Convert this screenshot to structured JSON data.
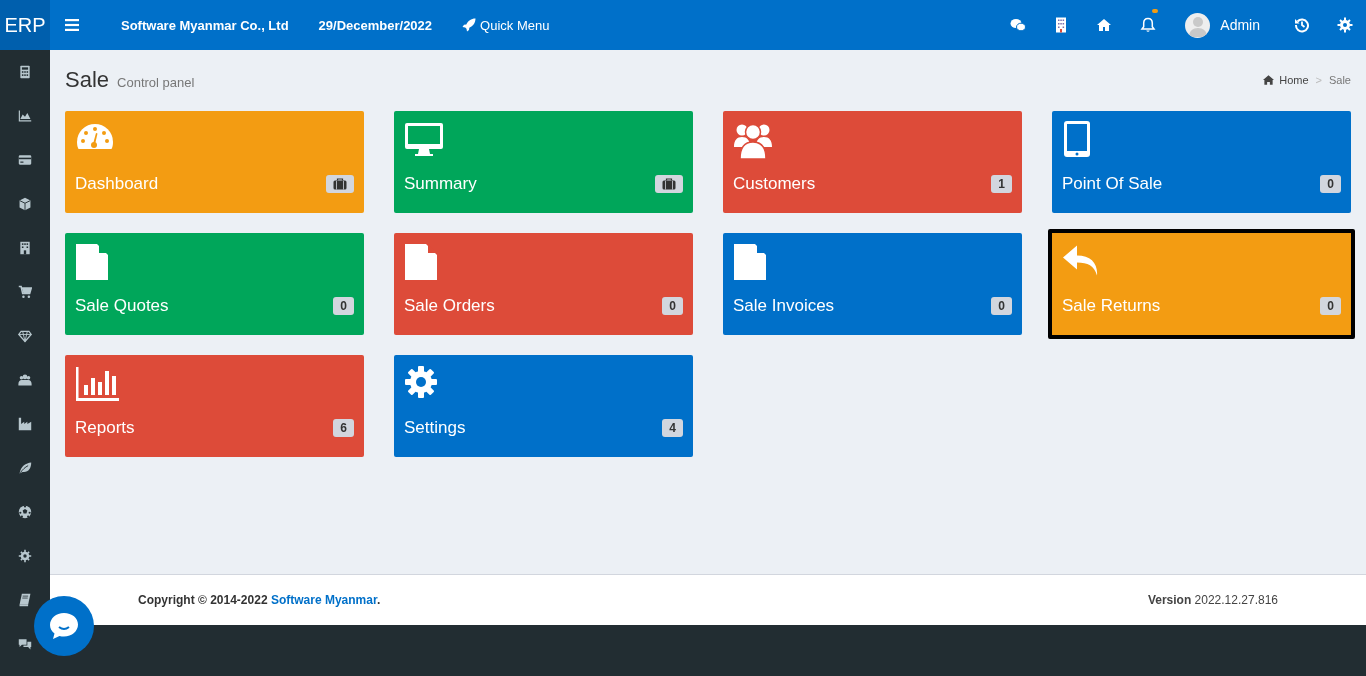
{
  "brand": "ERP",
  "topbar": {
    "company": "Software Myanmar Co., Ltd",
    "date": "29/December/2022",
    "quick_menu": "Quick Menu",
    "user": "Admin",
    "notification_dot": true
  },
  "page": {
    "title": "Sale",
    "subtitle": "Control panel"
  },
  "breadcrumb": {
    "home": "Home",
    "separator": ">",
    "current": "Sale"
  },
  "tiles": [
    {
      "label": "Dashboard",
      "kind": "gauge",
      "color": "#f39c12",
      "badge": {
        "kind": "icon"
      },
      "selected": false
    },
    {
      "label": "Summary",
      "kind": "monitor",
      "color": "#00a65a",
      "badge": {
        "kind": "icon"
      },
      "selected": false
    },
    {
      "label": "Customers",
      "kind": "users",
      "color": "#dd4b39",
      "badge": {
        "kind": "text",
        "text": "1"
      },
      "selected": false
    },
    {
      "label": "Point Of Sale",
      "kind": "tablet",
      "color": "#0070c9",
      "badge": {
        "kind": "text",
        "text": "0"
      },
      "selected": false
    },
    {
      "label": "Sale Quotes",
      "kind": "file",
      "color": "#00a65a",
      "badge": {
        "kind": "text",
        "text": "0"
      },
      "selected": false
    },
    {
      "label": "Sale Orders",
      "kind": "file",
      "color": "#dd4b39",
      "badge": {
        "kind": "text",
        "text": "0"
      },
      "selected": false
    },
    {
      "label": "Sale Invoices",
      "kind": "file",
      "color": "#0070c9",
      "badge": {
        "kind": "text",
        "text": "0"
      },
      "selected": false
    },
    {
      "label": "Sale Returns",
      "kind": "reply",
      "color": "#f39c12",
      "badge": {
        "kind": "text",
        "text": "0"
      },
      "selected": true
    },
    {
      "label": "Reports",
      "kind": "chart",
      "color": "#dd4b39",
      "badge": {
        "kind": "text",
        "text": "6"
      },
      "selected": false
    },
    {
      "label": "Settings",
      "kind": "gear",
      "color": "#0070c9",
      "badge": {
        "kind": "text",
        "text": "4"
      },
      "selected": false
    }
  ],
  "footer": {
    "copyright": "Copyright © 2014-2022 ",
    "link": "Software Myanmar",
    "suffix": ".",
    "version": "**Version** 2022.12.27.816"
  }
}
